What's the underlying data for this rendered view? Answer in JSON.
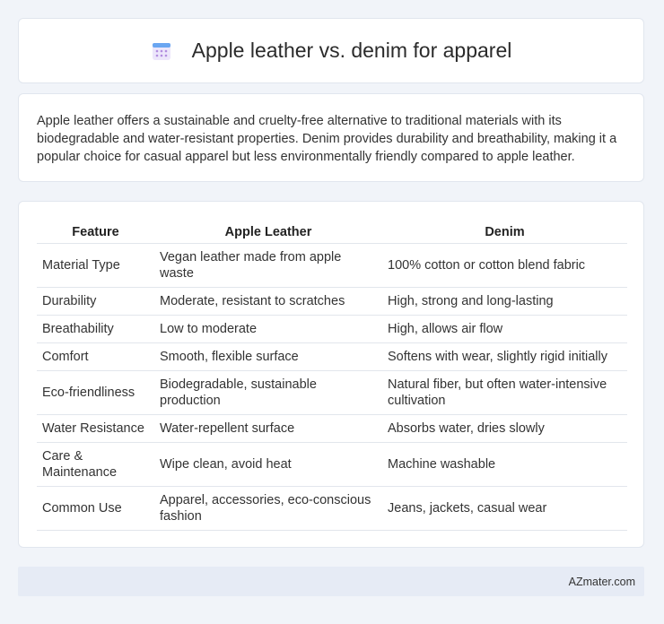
{
  "header": {
    "title": "Apple leather vs. denim for apparel",
    "icon": "calendar-icon"
  },
  "intro": {
    "text": "Apple leather offers a sustainable and cruelty-free alternative to traditional materials with its biodegradable and water-resistant properties. Denim provides durability and breathability, making it a popular choice for casual apparel but less environmentally friendly compared to apple leather."
  },
  "table": {
    "headers": [
      "Feature",
      "Apple Leather",
      "Denim"
    ],
    "rows": [
      [
        "Material Type",
        "Vegan leather made from apple waste",
        "100% cotton or cotton blend fabric"
      ],
      [
        "Durability",
        "Moderate, resistant to scratches",
        "High, strong and long-lasting"
      ],
      [
        "Breathability",
        "Low to moderate",
        "High, allows air flow"
      ],
      [
        "Comfort",
        "Smooth, flexible surface",
        "Softens with wear, slightly rigid initially"
      ],
      [
        "Eco-friendliness",
        "Biodegradable, sustainable production",
        "Natural fiber, but often water-intensive cultivation"
      ],
      [
        "Water Resistance",
        "Water-repellent surface",
        "Absorbs water, dries slowly"
      ],
      [
        "Care & Maintenance",
        "Wipe clean, avoid heat",
        "Machine washable"
      ],
      [
        "Common Use",
        "Apparel, accessories, eco-conscious fashion",
        "Jeans, jackets, casual wear"
      ]
    ]
  },
  "footer": {
    "brand": "AZmater.com"
  }
}
